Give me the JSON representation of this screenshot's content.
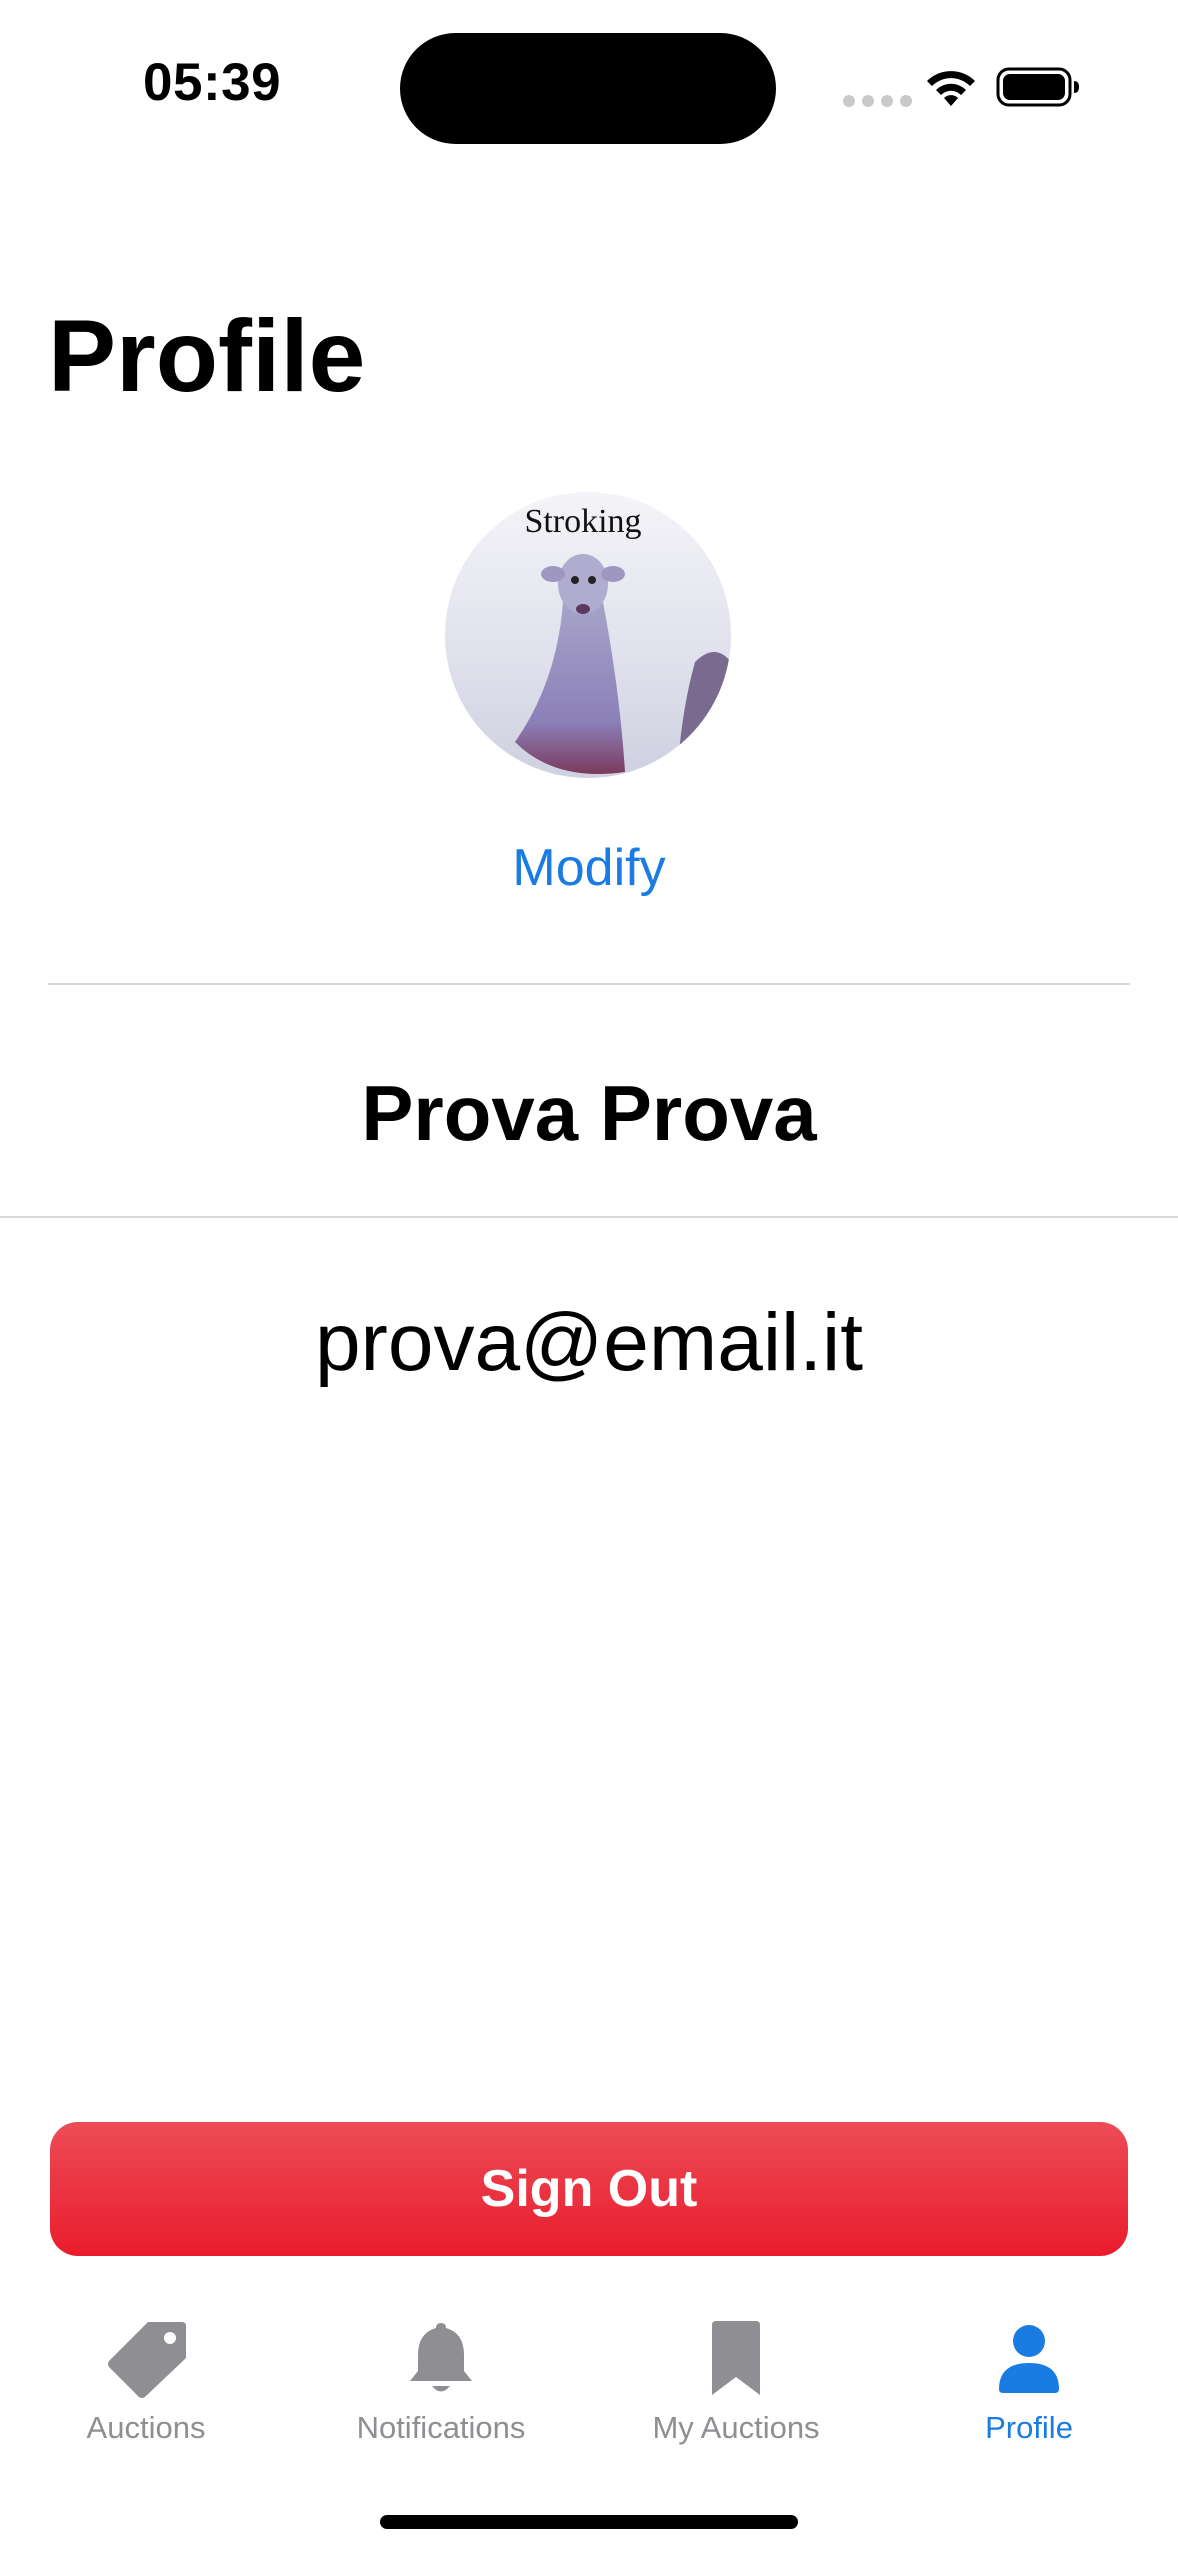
{
  "status_bar": {
    "time": "05:39"
  },
  "page": {
    "title": "Profile"
  },
  "avatar": {
    "image_text": "Stroking",
    "modify_label": "Modify"
  },
  "user": {
    "name": "Prova Prova",
    "email": "prova@email.it"
  },
  "actions": {
    "sign_out_label": "Sign Out"
  },
  "tab_bar": {
    "items": [
      {
        "label": "Auctions",
        "icon": "tag-icon",
        "active": false
      },
      {
        "label": "Notifications",
        "icon": "bell-icon",
        "active": false
      },
      {
        "label": "My Auctions",
        "icon": "bookmark-icon",
        "active": false
      },
      {
        "label": "Profile",
        "icon": "person-icon",
        "active": true
      }
    ]
  },
  "colors": {
    "accent": "#1a7be2",
    "destructive": "#ea1c2c",
    "inactive_tab": "#8e8e93"
  }
}
